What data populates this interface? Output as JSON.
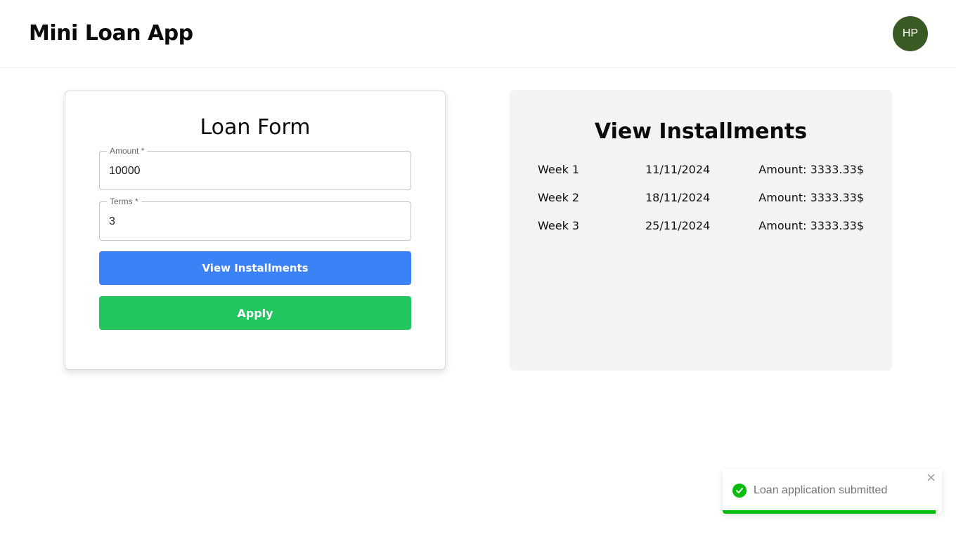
{
  "header": {
    "app_title": "Mini Loan App",
    "avatar_initials": "HP"
  },
  "loan_form": {
    "title": "Loan Form",
    "amount_label": "Amount *",
    "amount_value": "10000",
    "terms_label": "Terms *",
    "terms_value": "3",
    "view_installments_label": "View Installments",
    "apply_label": "Apply"
  },
  "installments": {
    "title": "View Installments",
    "rows": [
      {
        "week": "Week 1",
        "date": "11/11/2024",
        "amount": "Amount: 3333.33$"
      },
      {
        "week": "Week 2",
        "date": "18/11/2024",
        "amount": "Amount: 3333.33$"
      },
      {
        "week": "Week 3",
        "date": "25/11/2024",
        "amount": "Amount: 3333.33$"
      }
    ]
  },
  "toast": {
    "message": "Loan application submitted",
    "icon": "check-circle-icon",
    "close_glyph": "×",
    "progress_fraction": 0.97
  },
  "colors": {
    "avatar_bg": "#3a5a24",
    "view_button": "#3b82f6",
    "apply_button": "#22c55e",
    "toast_success": "#07bc0c",
    "installments_bg": "#f2f3f5"
  }
}
